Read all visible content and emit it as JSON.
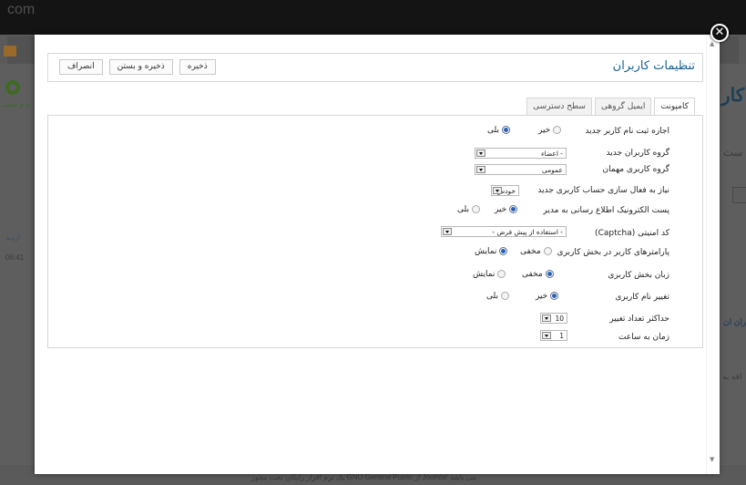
{
  "background": {
    "site_text": "com",
    "left_title": "ندم محت",
    "right_title": "کار",
    "row_text_1": "اردید",
    "row_text_2": "06:41",
    "side_text_1": "ست",
    "side_text_2": "ران ان",
    "side_text_3": "اقه به",
    "footer_text": "یک نرم افزار رایگان تحت مجوز GNU General Public از Joomla! می باشد."
  },
  "modal": {
    "title": "تنظیمات کاربران",
    "close_glyph": "✕",
    "toolbar": {
      "save_label": "ذخیره",
      "save_close_label": "ذخیره و بستن",
      "cancel_label": "انصراف"
    },
    "tabs": [
      {
        "label": "کامپونت",
        "active": true
      },
      {
        "label": "ایمیل گروهی",
        "active": false
      },
      {
        "label": "سطح دسترسی",
        "active": false
      }
    ],
    "fields": {
      "allow_registration": {
        "label": "اجازه ثبت نام کاربر جدید",
        "opt_no": "خیر",
        "opt_yes": "بلی",
        "selected": "yes"
      },
      "new_user_group": {
        "label": "گروه کاربران جدید",
        "value": "- اعضاء"
      },
      "guest_user_group": {
        "label": "گروه کاربری مهمان",
        "value": "عمومی"
      },
      "activation": {
        "label": "نیاز به فعال سازی حساب کاربری جدید",
        "value": "خودش"
      },
      "notify_admin": {
        "label": "پست الکترونیک اطلاع رسانی به مدیر",
        "opt_no": "خیر",
        "opt_yes": "بلی",
        "selected": "no"
      },
      "captcha": {
        "label": "کد امنیتی (Captcha)",
        "value": "- استفاده از پیش فرض -"
      },
      "frontend_params": {
        "label": "پارامترهای کاربر در بخش کاربری",
        "opt_hide": "مخفی",
        "opt_show": "نمایش",
        "selected": "show"
      },
      "frontend_language": {
        "label": "زبان بخش کاربری",
        "opt_hide": "مخفی",
        "opt_show": "نمایش",
        "selected": "hide"
      },
      "change_username": {
        "label": "تغییر نام کاربری",
        "opt_no": "خیر",
        "opt_yes": "بلی",
        "selected": "no"
      },
      "max_changes": {
        "label": "حداکثر تعداد تغییر",
        "value": "10"
      },
      "time_hours": {
        "label": "زمان به ساعت",
        "value": "1"
      }
    }
  }
}
